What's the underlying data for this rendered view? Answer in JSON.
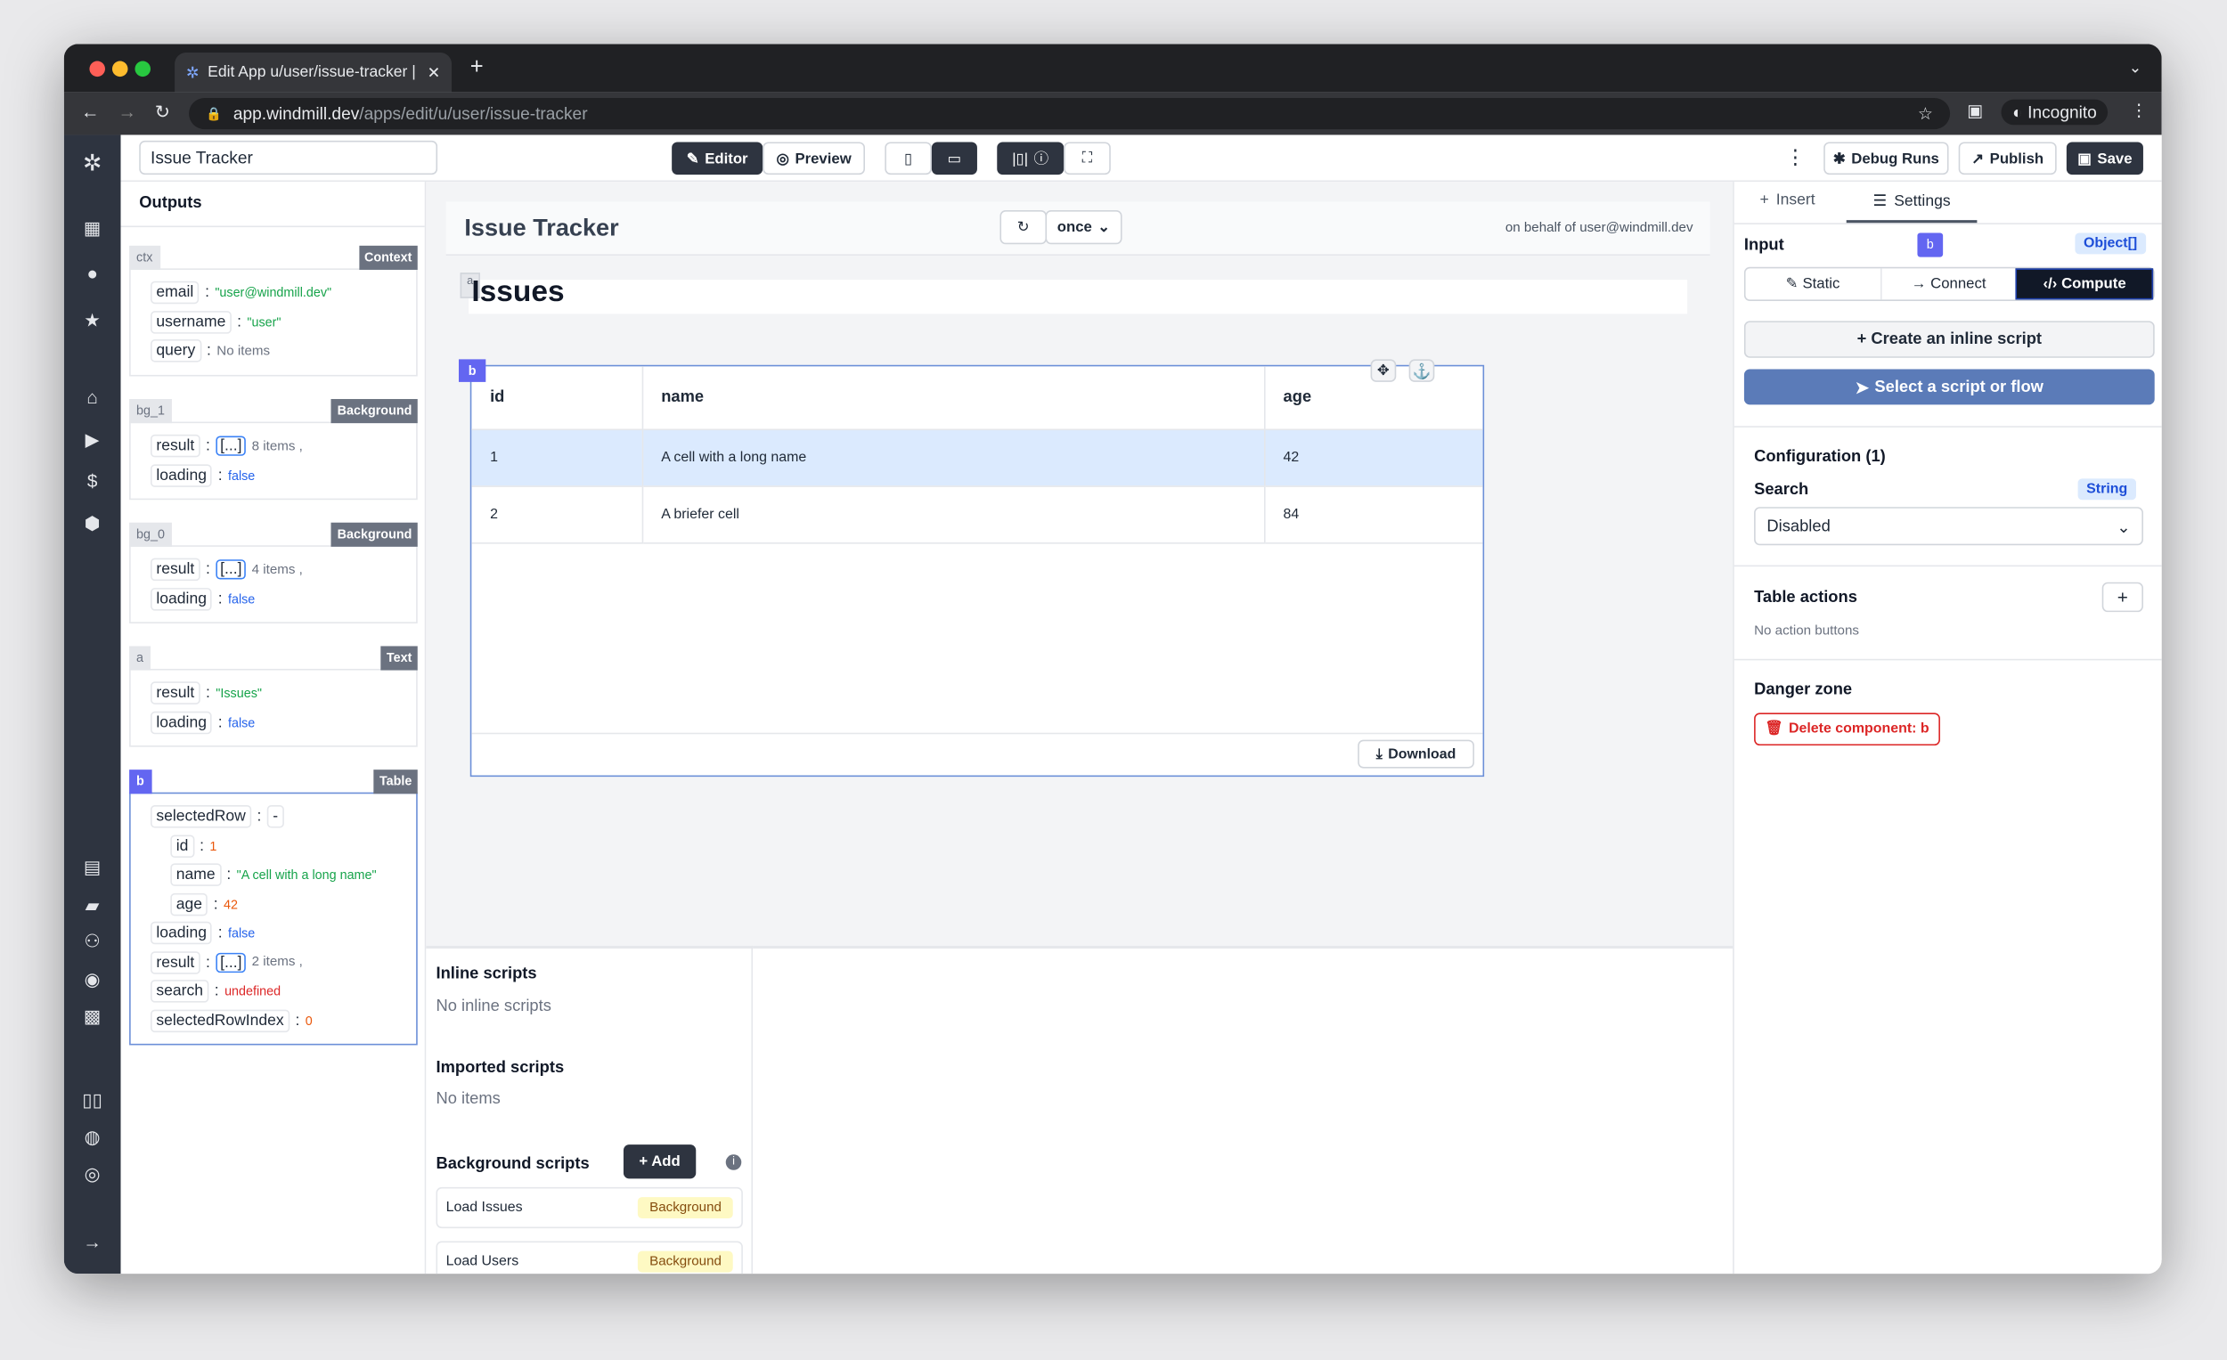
{
  "browser": {
    "tab_title": "Edit App u/user/issue-tracker |",
    "url_host": "app.windmill.dev",
    "url_path": "/apps/edit/u/user/issue-tracker",
    "profile": "Incognito"
  },
  "toolbar": {
    "app_name": "Issue Tracker",
    "editor": "Editor",
    "preview": "Preview",
    "debug_runs": "Debug Runs",
    "publish": "Publish",
    "save": "Save"
  },
  "outputs": {
    "title": "Outputs",
    "components": [
      {
        "id": "ctx",
        "type": "Context",
        "fields": [
          {
            "k": "email",
            "v": "\"user@windmill.dev\""
          },
          {
            "k": "username",
            "v": "\"user\""
          },
          {
            "k": "query",
            "v": "No items"
          }
        ]
      },
      {
        "id": "bg_1",
        "type": "Background",
        "fields": [
          {
            "k": "result",
            "v": "[...]",
            "extra": "8 items ,"
          },
          {
            "k": "loading",
            "v": "false"
          }
        ]
      },
      {
        "id": "bg_0",
        "type": "Background",
        "fields": [
          {
            "k": "result",
            "v": "[...]",
            "extra": "4 items ,"
          },
          {
            "k": "loading",
            "v": "false"
          }
        ]
      },
      {
        "id": "a",
        "type": "Text",
        "fields": [
          {
            "k": "result",
            "v": "\"Issues\""
          },
          {
            "k": "loading",
            "v": "false"
          }
        ]
      },
      {
        "id": "b",
        "type": "Table",
        "fields": [
          {
            "k": "selectedRow",
            "v": "-"
          },
          {
            "k": "id",
            "v": "1"
          },
          {
            "k": "name",
            "v": "\"A cell with a long name\""
          },
          {
            "k": "age",
            "v": "42"
          },
          {
            "k": "loading",
            "v": "false"
          },
          {
            "k": "result",
            "v": "[...]",
            "extra": "2 items ,"
          },
          {
            "k": "search",
            "v": "undefined"
          },
          {
            "k": "selectedRowIndex",
            "v": "0"
          }
        ]
      }
    ]
  },
  "canvas": {
    "title": "Issue Tracker",
    "refresh": "once",
    "behalf": "on behalf of user@windmill.dev",
    "text_id": "a",
    "text": "Issues",
    "table_id": "b",
    "columns": [
      "id",
      "name",
      "age"
    ],
    "rows": [
      [
        "1",
        "A cell with a long name",
        "42"
      ],
      [
        "2",
        "A briefer cell",
        "84"
      ]
    ],
    "download": "Download"
  },
  "scripts": {
    "inline_title": "Inline scripts",
    "inline_empty": "No inline scripts",
    "imported_title": "Imported scripts",
    "imported_empty": "No items",
    "bg_title": "Background scripts",
    "add": "+ Add",
    "bg_items": [
      {
        "name": "Load Issues",
        "tag": "Background"
      },
      {
        "name": "Load Users",
        "tag": "Background"
      }
    ]
  },
  "settings": {
    "tab_insert": "Insert",
    "tab_settings": "Settings",
    "input_label": "Input",
    "component": "b",
    "input_type": "Object[]",
    "modes": [
      "Static",
      "Connect",
      "Compute"
    ],
    "create_inline": "+ Create an inline script",
    "select_script": "Select a script or flow",
    "config_title": "Configuration (1)",
    "search_label": "Search",
    "search_type": "String",
    "search_value": "Disabled",
    "actions_title": "Table actions",
    "actions_empty": "No action buttons",
    "danger_title": "Danger zone",
    "delete": "Delete component: b"
  },
  "colors": {
    "accent": "#6366f1",
    "dark": "#2e3440",
    "select_btn": "#5b7bb8"
  }
}
